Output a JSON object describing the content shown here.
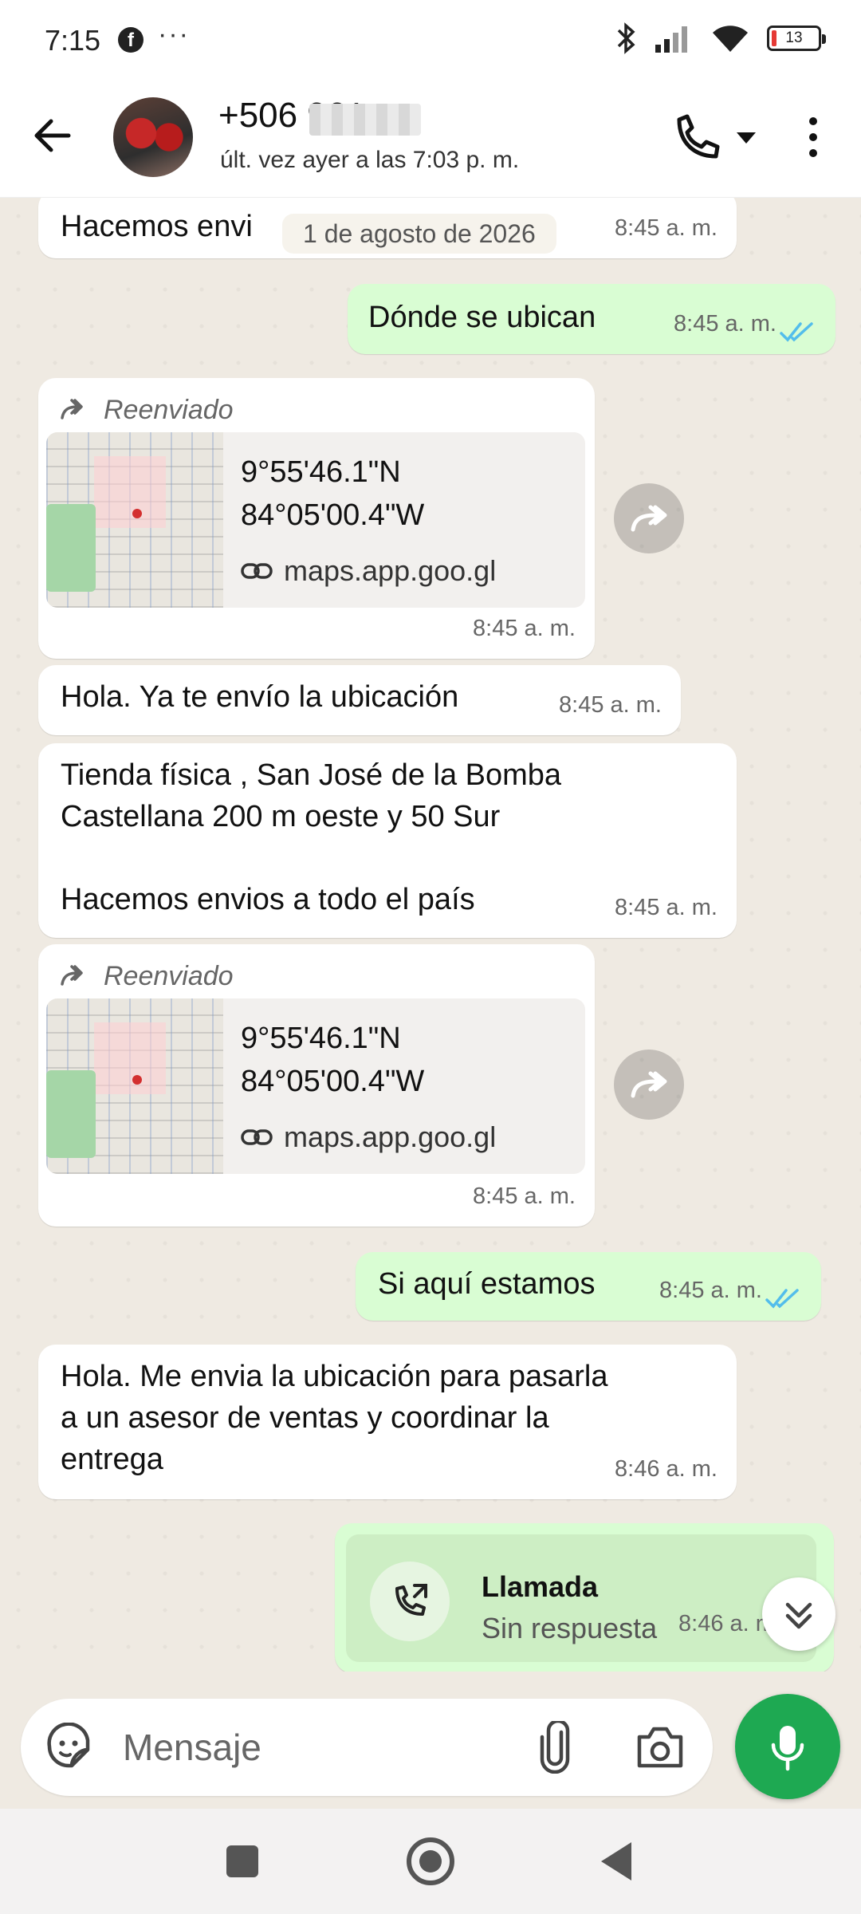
{
  "status_bar": {
    "time": "7:15",
    "battery": "13"
  },
  "header": {
    "contact_name": "+506 961",
    "last_seen": "últ. vez ayer a las 7:03 p. m."
  },
  "date_chip": "1 de agosto de 2026",
  "messages": [
    {
      "text": "Hacemos envi",
      "time": "8:45 a. m."
    },
    {
      "text": "Dónde se ubican",
      "time": "8:45 a. m."
    },
    {
      "forwarded": "Reenviado",
      "lat": "9°55'46.1\"N",
      "lon": "84°05'00.4\"W",
      "link": "maps.app.goo.gl",
      "time": "8:45 a. m."
    },
    {
      "text": "Hola. Ya te envío la ubicación",
      "time": "8:45 a. m."
    },
    {
      "text": "Tienda física , San José de la Bomba\nCastellana 200 m oeste y 50 Sur\n\nHacemos envios a todo el país",
      "time": "8:45 a. m."
    },
    {
      "forwarded": "Reenviado",
      "lat": "9°55'46.1\"N",
      "lon": "84°05'00.4\"W",
      "link": "maps.app.goo.gl",
      "time": "8:45 a. m."
    },
    {
      "text": "Si aquí estamos",
      "time": "8:45 a. m."
    },
    {
      "text": "Hola. Me envia la ubicación para pasarla\na un asesor de ventas y coordinar la\nentrega",
      "time": "8:46 a. m."
    },
    {
      "call_title": "Llamada",
      "call_status": "Sin respuesta",
      "time": "8:46 a. m."
    }
  ],
  "input": {
    "placeholder": "Mensaje"
  },
  "colors": {
    "accent": "#1ea952",
    "outgoing_bubble": "#d9fdd3",
    "tick_blue": "#53bdeb",
    "chat_bg": "#efeae2"
  }
}
